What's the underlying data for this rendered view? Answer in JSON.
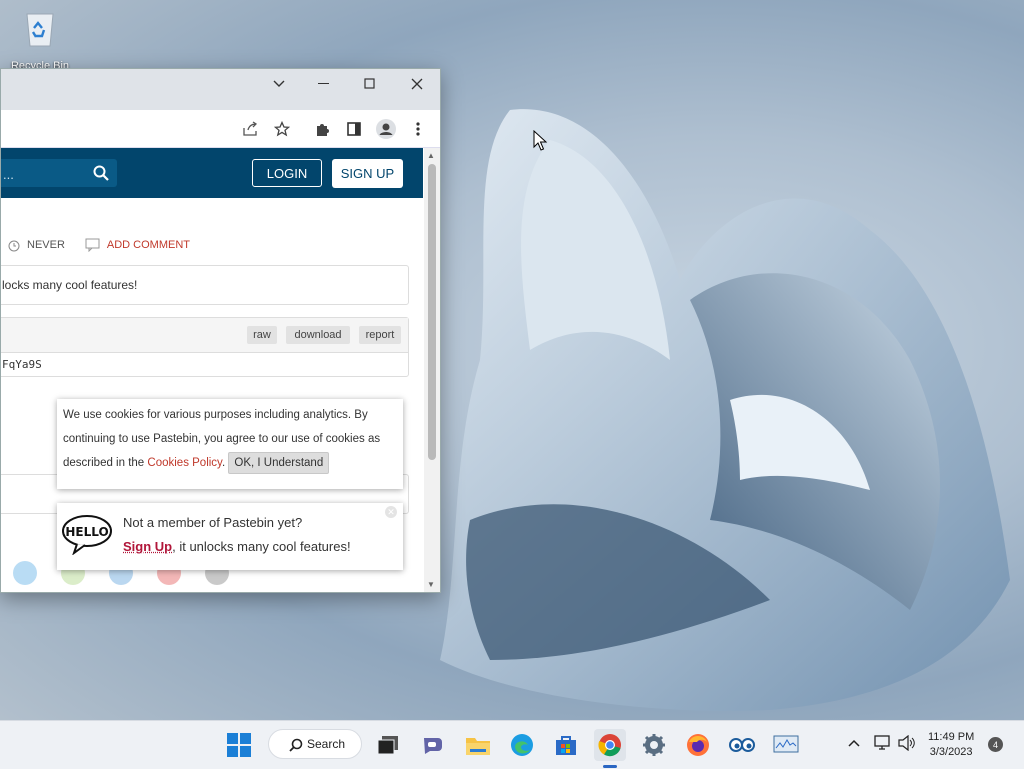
{
  "desktop": {
    "recycle_bin_label": "Recycle Bin"
  },
  "window": {
    "controls": {
      "tab_search": "chevron-down-icon",
      "minimize": "minimize-icon",
      "maximize": "maximize-icon",
      "close": "close-icon"
    }
  },
  "toolbar": {
    "icons": [
      "share-icon",
      "star-icon",
      "extensions-icon",
      "side-panel-icon",
      "profile-icon",
      "menu-icon"
    ]
  },
  "pastebin": {
    "search_partial": "...",
    "login_label": "LOGIN",
    "signup_label": "SIGN UP",
    "expire_label": "NEVER",
    "add_comment_label": "ADD COMMENT",
    "promo_partial": "locks many cool features!",
    "raw_label": "raw",
    "download_label": "download",
    "report_label": "report",
    "code_partial": "FqYa9S"
  },
  "cookie_notice": {
    "text_before_link": "We use cookies for various purposes including analytics. By continuing to use Pastebin, you agree to our use of cookies as described in the ",
    "link_text": "Cookies Policy",
    "after_link": ".",
    "ok_label": "OK, I Understand"
  },
  "member_popup": {
    "hello_text": "HELLO",
    "line1": "Not a member of Pastebin yet?",
    "signup_link": "Sign Up",
    "line2_rest": ", it unlocks many cool features!"
  },
  "taskbar": {
    "search_label": "Search",
    "time": "11:49 PM",
    "date": "3/3/2023",
    "notification_count": "4",
    "apps": [
      "start",
      "search",
      "task-view",
      "teams",
      "file-explorer",
      "edge",
      "store",
      "chrome",
      "settings",
      "firefox",
      "app-eyes",
      "monitor"
    ]
  },
  "colors": {
    "pastebin_header": "#02456c",
    "accent_red": "#c0392b",
    "signup_magenta": "#b1163a"
  }
}
